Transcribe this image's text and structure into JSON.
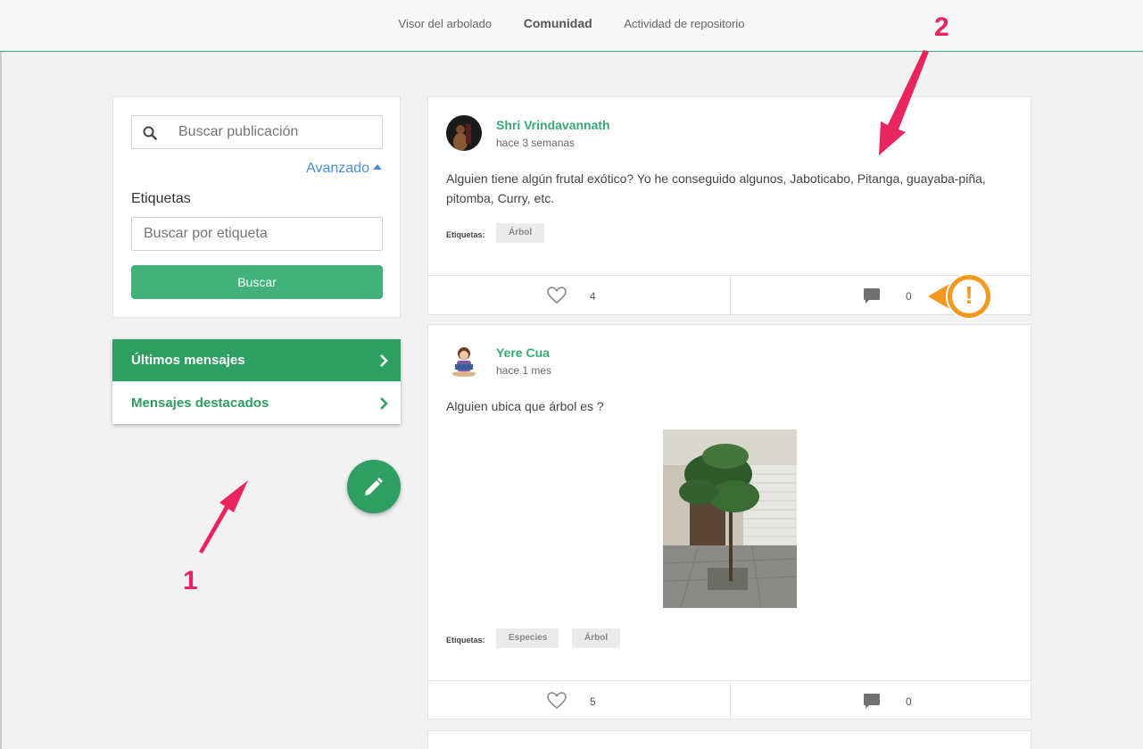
{
  "nav": {
    "items": [
      {
        "label": "Visor del arbolado",
        "active": false
      },
      {
        "label": "Comunidad",
        "active": true
      },
      {
        "label": "Actividad de repositorio",
        "active": false
      }
    ]
  },
  "search": {
    "placeholder": "Buscar publicación",
    "advanced_label": "Avanzado",
    "tags_label": "Etiquetas",
    "tag_placeholder": "Buscar por etiqueta",
    "button_label": "Buscar"
  },
  "menu": {
    "latest": "Últimos mensajes",
    "featured": "Mensajes destacados"
  },
  "posts": [
    {
      "author": "Shri Vrindavannath",
      "time": "hace 3 semanas",
      "text": "Alguien tiene algún frutal exótico? Yo he conseguido algunos, Jaboticabo, Pitanga, guayaba-piña, pitomba, Curry, etc.",
      "tags_label": "Etiquetas:",
      "tags": [
        "Árbol"
      ],
      "likes": "4",
      "comments": "0"
    },
    {
      "author": "Yere Cua",
      "time": "hace 1 mes",
      "text": "Alguien ubica que árbol es ?",
      "tags_label": "Etiquetas:",
      "tags": [
        "Especies",
        "Árbol"
      ],
      "likes": "5",
      "comments": "0"
    }
  ],
  "annotations": {
    "one": "1",
    "two": "2",
    "badge": "!"
  },
  "colors": {
    "brand_green": "#2e9e62",
    "button_green": "#40b27a",
    "link_blue": "#4a8fd6",
    "annotation_pink": "#e8255f",
    "badge_orange": "#f39a1e"
  }
}
